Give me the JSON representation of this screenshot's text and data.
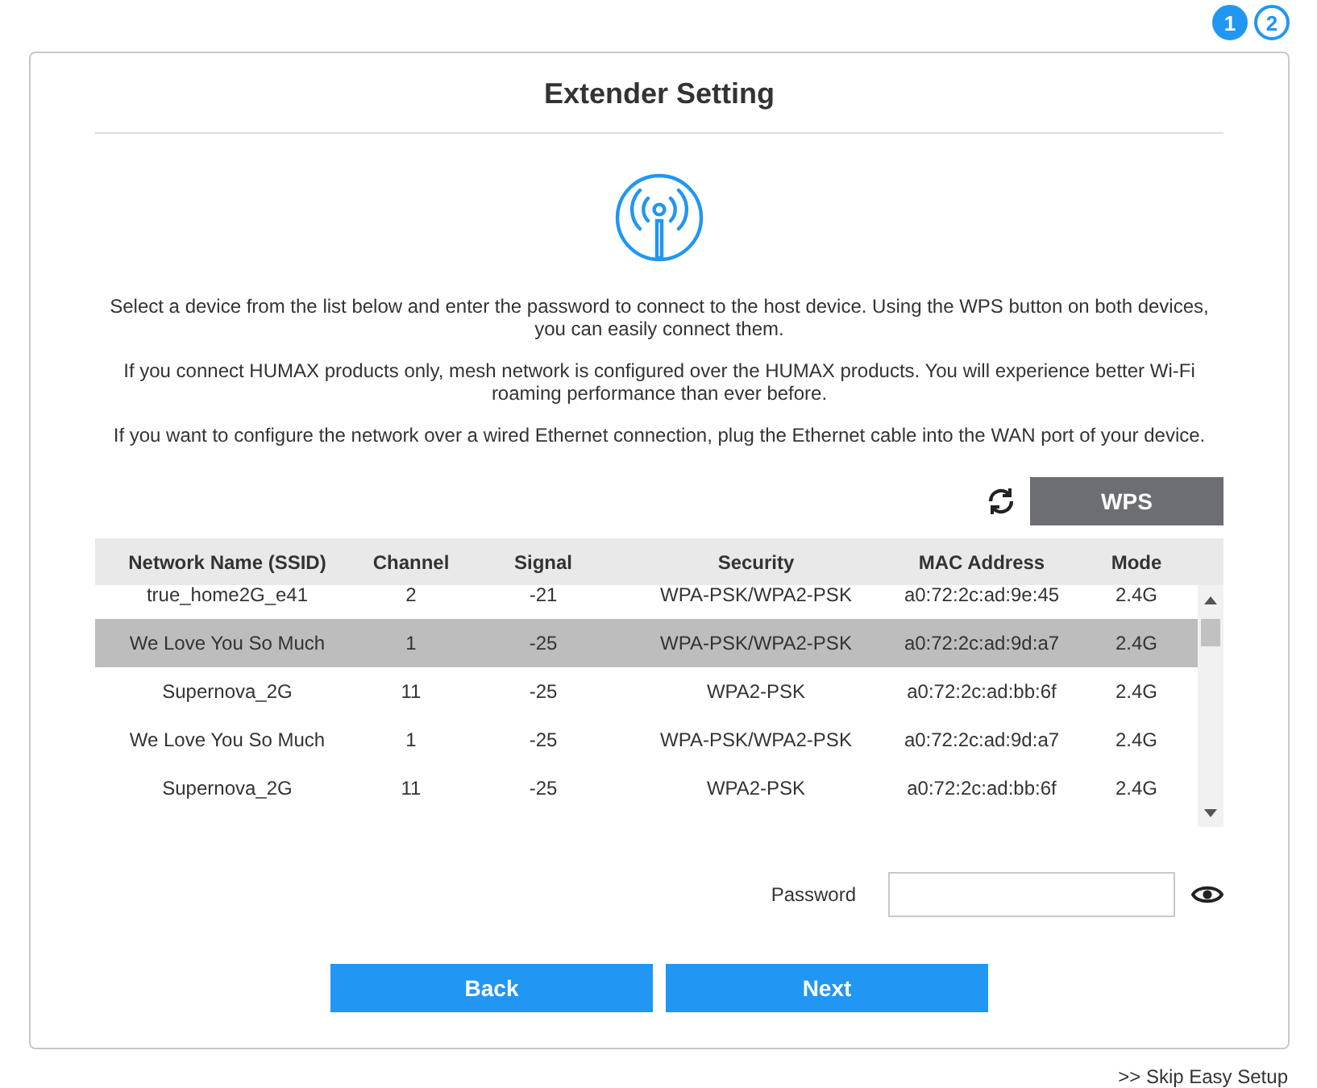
{
  "steps": [
    {
      "label": "1",
      "selected": true
    },
    {
      "label": "2",
      "selected": false
    }
  ],
  "title": "Extender Setting",
  "paragraphs": [
    "Select a device from the list below and enter the password to connect to the host device. Using the WPS button on both devices, you can easily connect them.",
    "If you connect HUMAX products only, mesh network is configured over the HUMAX products. You will experience better Wi-Fi roaming performance than ever before.",
    "If you want to configure the network over a wired Ethernet connection, plug the Ethernet cable into the WAN port of your device."
  ],
  "wps_button": "WPS",
  "table": {
    "columns": [
      "Network Name (SSID)",
      "Channel",
      "Signal",
      "Security",
      "MAC Address",
      "Mode"
    ],
    "rows": [
      {
        "cells": [
          "true_home2G_e41",
          "2",
          "-21",
          "WPA-PSK/WPA2-PSK",
          "a0:72:2c:ad:9e:45",
          "2.4G"
        ],
        "selected": false
      },
      {
        "cells": [
          "We Love You So Much",
          "1",
          "-25",
          "WPA-PSK/WPA2-PSK",
          "a0:72:2c:ad:9d:a7",
          "2.4G"
        ],
        "selected": true
      },
      {
        "cells": [
          "Supernova_2G",
          "11",
          "-25",
          "WPA2-PSK",
          "a0:72:2c:ad:bb:6f",
          "2.4G"
        ],
        "selected": false
      },
      {
        "cells": [
          "We Love You So Much",
          "1",
          "-25",
          "WPA-PSK/WPA2-PSK",
          "a0:72:2c:ad:9d:a7",
          "2.4G"
        ],
        "selected": false
      },
      {
        "cells": [
          "Supernova_2G",
          "11",
          "-25",
          "WPA2-PSK",
          "a0:72:2c:ad:bb:6f",
          "2.4G"
        ],
        "selected": false
      }
    ]
  },
  "password": {
    "label": "Password"
  },
  "buttons": [
    "Back",
    "Next"
  ],
  "skip_link": ">> Skip Easy Setup"
}
